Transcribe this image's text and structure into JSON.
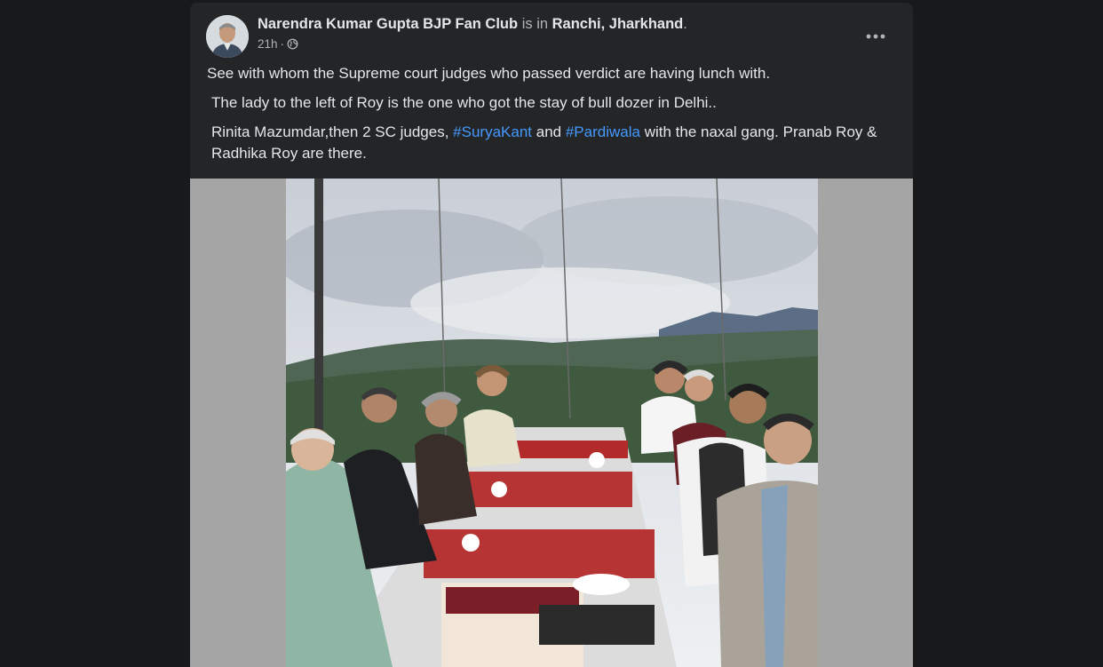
{
  "post": {
    "author": "Narendra Kumar Gupta BJP Fan Club",
    "is_in": "is in",
    "location": "Ranchi, Jharkhand",
    "period": ".",
    "time": "21h",
    "dot": "·",
    "privacy_icon": "globe-icon",
    "more_icon": "more-horizontal-icon",
    "text": {
      "p1": "See with whom the Supreme court judges who passed verdict are having lunch with.",
      "p2": "The lady to the left of Roy is the one who got the stay of bull dozer in Delhi..",
      "p3_start": "Rinita Mazumdar,then 2 SC judges,",
      "hashtag1": "#SuryaKant",
      "p3_and": "and",
      "hashtag2": "#Pardiwala",
      "p3_end": "with the naxal gang.  Pranab Roy & Radhika Roy are  there."
    }
  },
  "colors": {
    "page_bg": "#18191a",
    "card_bg": "#242526",
    "primary_text": "#e4e6eb",
    "secondary_text": "#b0b3b8",
    "hashtag": "#4599ff"
  }
}
